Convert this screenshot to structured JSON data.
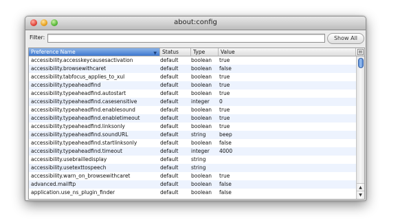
{
  "window": {
    "title": "about:config"
  },
  "filter": {
    "label": "Filter:",
    "value": "",
    "show_all": "Show All"
  },
  "table": {
    "columns": [
      "Preference Name",
      "Status",
      "Type",
      "Value"
    ],
    "rows": [
      [
        "accessibility.accesskeycausesactivation",
        "default",
        "boolean",
        "true"
      ],
      [
        "accessibility.browsewithcaret",
        "default",
        "boolean",
        "false"
      ],
      [
        "accessibility.tabfocus_applies_to_xul",
        "default",
        "boolean",
        "true"
      ],
      [
        "accessibility.typeaheadfind",
        "default",
        "boolean",
        "true"
      ],
      [
        "accessibility.typeaheadfind.autostart",
        "default",
        "boolean",
        "true"
      ],
      [
        "accessibility.typeaheadfind.casesensitive",
        "default",
        "integer",
        "0"
      ],
      [
        "accessibility.typeaheadfind.enablesound",
        "default",
        "boolean",
        "true"
      ],
      [
        "accessibility.typeaheadfind.enabletimeout",
        "default",
        "boolean",
        "true"
      ],
      [
        "accessibility.typeaheadfind.linksonly",
        "default",
        "boolean",
        "true"
      ],
      [
        "accessibility.typeaheadfind.soundURL",
        "default",
        "string",
        "beep"
      ],
      [
        "accessibility.typeaheadfind.startlinksonly",
        "default",
        "boolean",
        "false"
      ],
      [
        "accessibility.typeaheadfind.timeout",
        "default",
        "integer",
        "4000"
      ],
      [
        "accessibility.usebrailledisplay",
        "default",
        "string",
        ""
      ],
      [
        "accessibility.usetexttospeech",
        "default",
        "string",
        ""
      ],
      [
        "accessibility.warn_on_browsewithcaret",
        "default",
        "boolean",
        "true"
      ],
      [
        "advanced.mailftp",
        "default",
        "boolean",
        "false"
      ],
      [
        "application.use_ns_plugin_finder",
        "default",
        "boolean",
        "false"
      ]
    ]
  },
  "icons": {
    "sort": "triangle-down-icon",
    "column_picker": "column-picker-icon",
    "scroll_up": "triangle-up-icon",
    "scroll_down": "triangle-down-icon"
  },
  "colors": {
    "sorted_header": "#3d78cf",
    "alt_row": "#edf3fe",
    "scroll_thumb": "#5b8fd7"
  }
}
